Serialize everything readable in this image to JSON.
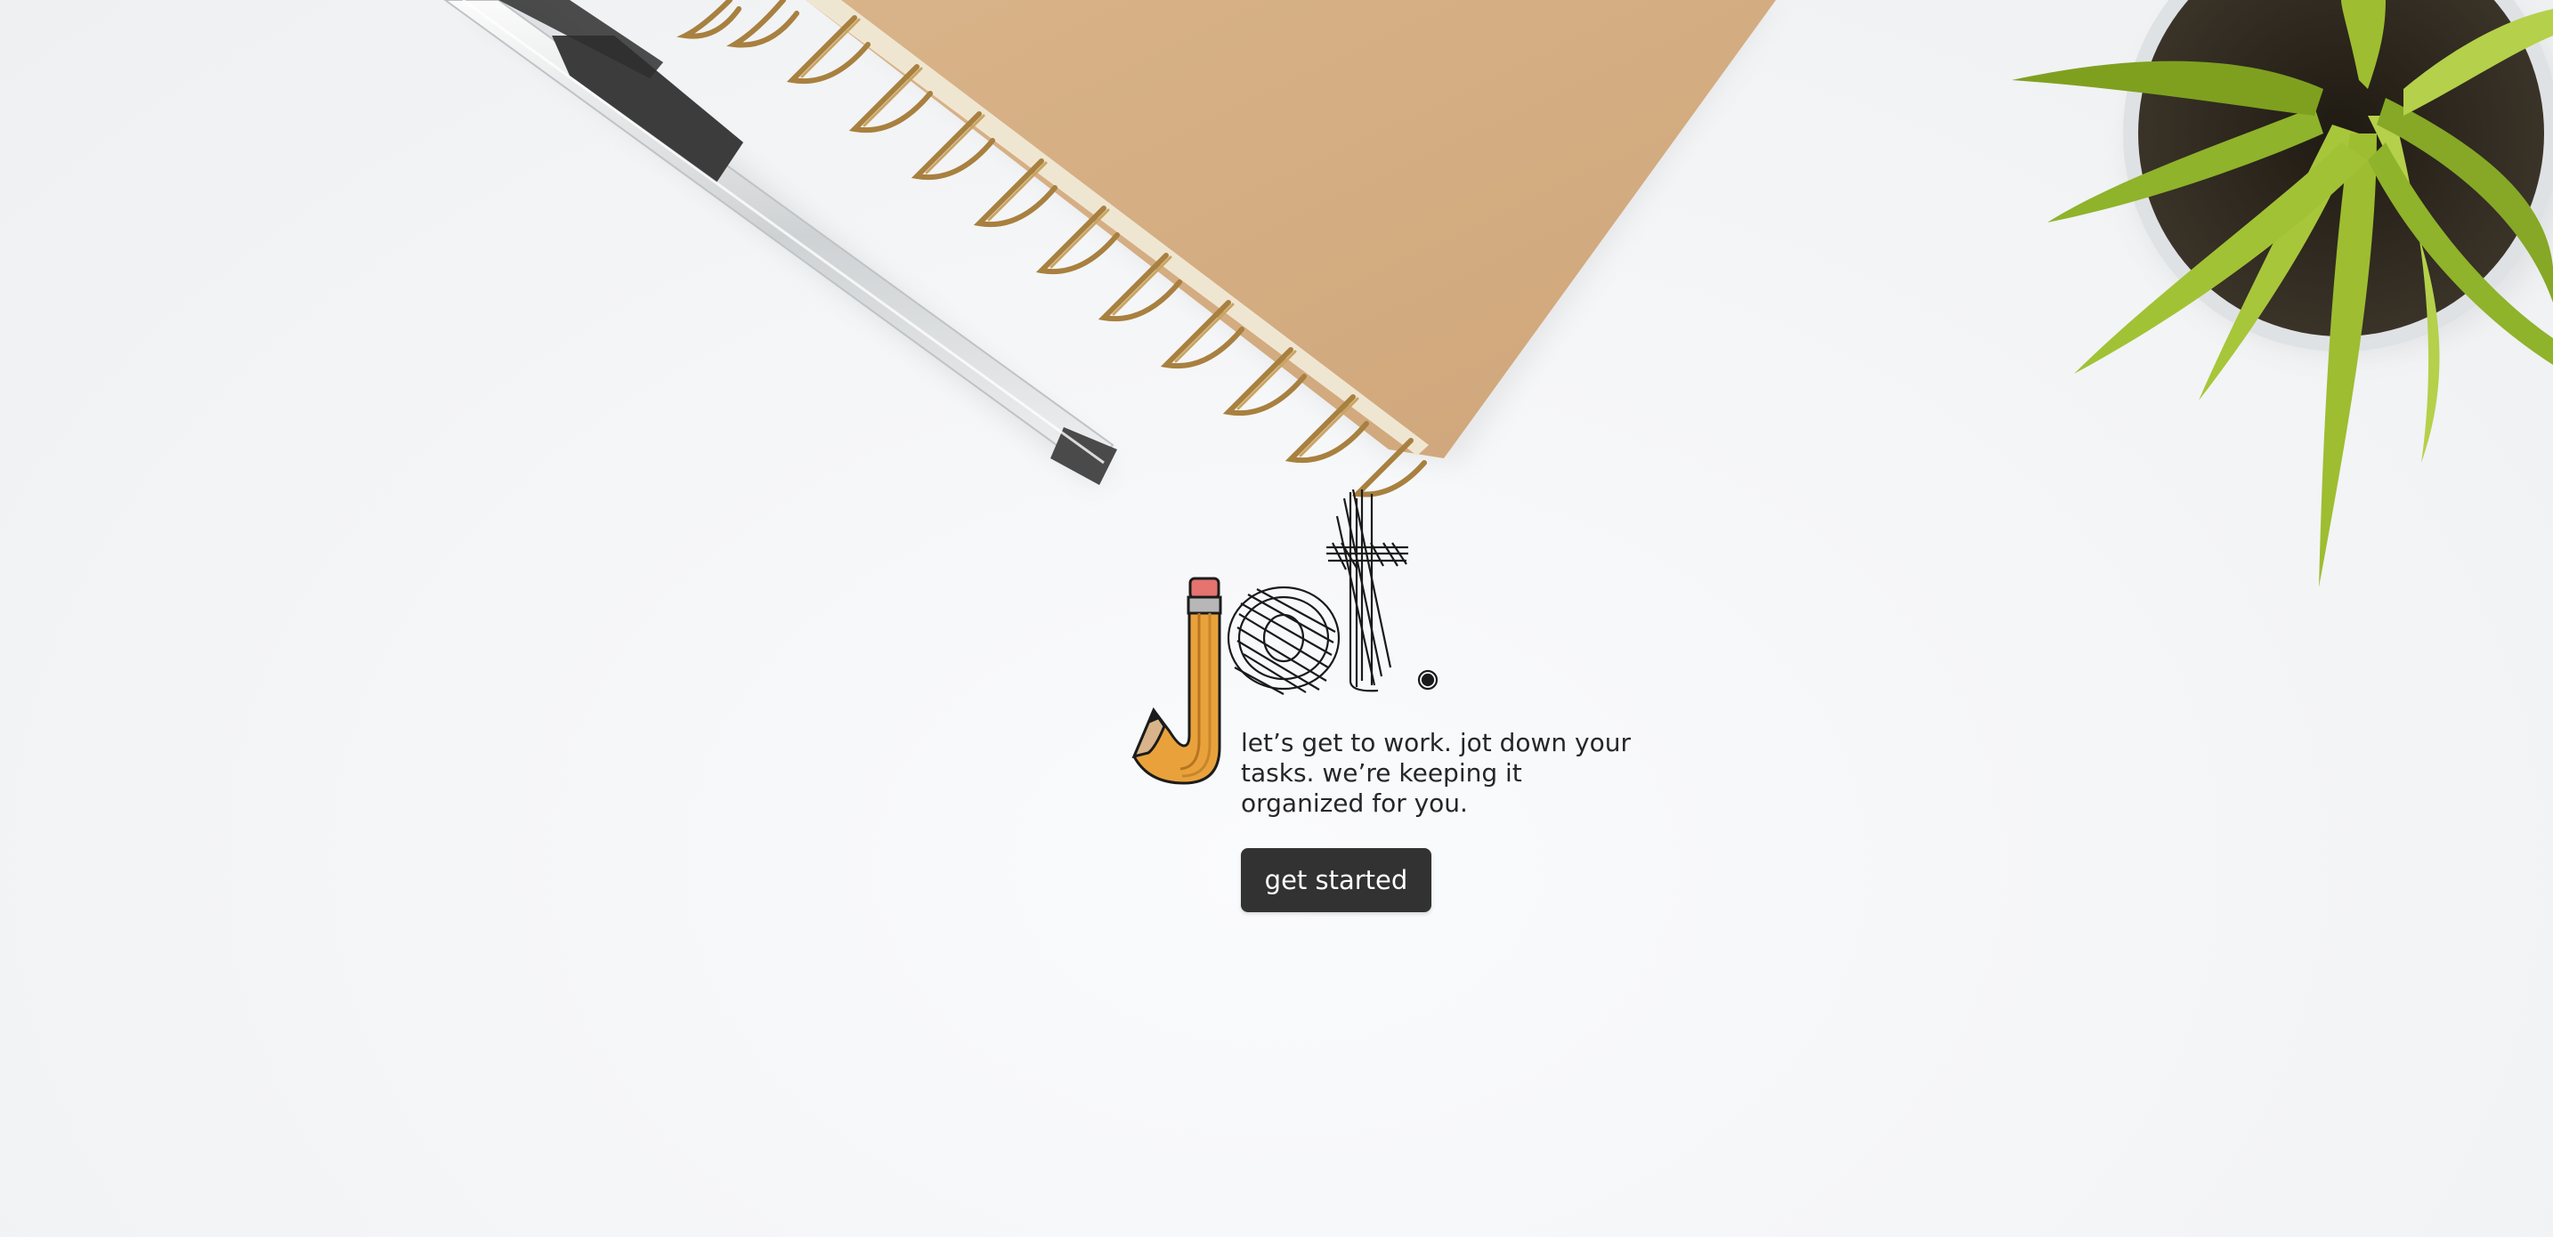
{
  "brand": {
    "name": "jot."
  },
  "hero": {
    "tagline": "let’s get to work. jot down your tasks. we’re keeping it organized for you.",
    "cta_label": "get started"
  },
  "background": {
    "objects": [
      "pen-image",
      "spiral-notebook-image",
      "potted-plant-image"
    ]
  },
  "colors": {
    "button_bg": "#323232",
    "button_text": "#ffffff",
    "text": "#262626",
    "pencil_orange": "#e9a23b",
    "eraser_pink": "#e5736f",
    "notebook_kraft": "#d6ae82",
    "plant_green": "#8fb32a"
  }
}
